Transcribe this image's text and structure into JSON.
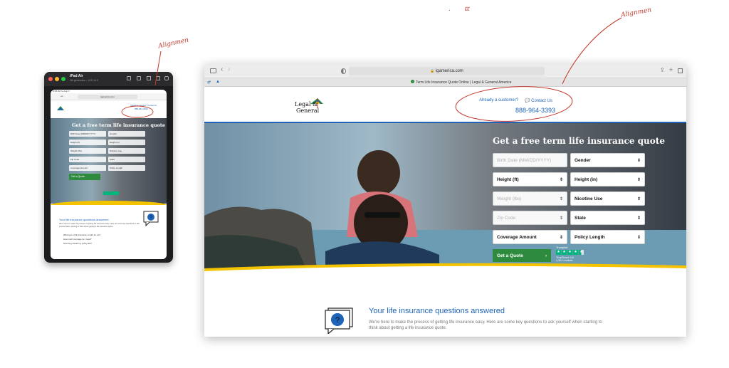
{
  "annotations": {
    "top_note": "ㄸ",
    "top_dot": ".",
    "ipad_note": "Alignmen",
    "browser_note": "Alignmen"
  },
  "simulator": {
    "device_name": "iPad Air",
    "device_sub": "4th generation – iOS 14.0",
    "status_time": "11:58 AM  Tue Aug 17",
    "address": "lgamerica.com",
    "tab_text": "aA",
    "mini_header": "Already a customer?  Contact Us",
    "mini_phone": "888-964-3393",
    "hero_title": "Get a free term life insurance quote",
    "fields": [
      [
        "Birth Date (MM/DD/YYYY)",
        "Gender"
      ],
      [
        "Height (ft)",
        "Height (in)"
      ],
      [
        "Weight (lbs)",
        "Nicotine Use"
      ],
      [
        "Zip Code",
        "State"
      ],
      [
        "Coverage Amount",
        "Policy Length"
      ]
    ],
    "cta": "Get a Quote",
    "section_title": "Your life insurance questions answered",
    "section_text": "We're here to make the process of getting life insurance easy. Here are some key questions to ask yourself when starting to think about getting a life insurance quote.",
    "q1": "What type of life insurance is right for me?",
    "q2": "How much coverage do I need?",
    "q3": "How long should my policy last?"
  },
  "browser": {
    "address": "lgamerica.com",
    "tab_title": "Term Life Insurance Quote Online | Legal & General America",
    "colors": {
      "accent": "#1d63b8",
      "cta_green": "#2e8b3e",
      "trustpilot": "#00b67a",
      "yellow": "#f3c300"
    }
  },
  "site": {
    "logo_line1": "Legal &",
    "logo_line2": "General",
    "already_customer": "Already a customer?",
    "contact_us": "Contact Us",
    "phone": "888-964-3393",
    "hero_title": "Get a free term life insurance quote",
    "form": {
      "birth_date": "Birth Date (MM/DD/YYYY)",
      "gender": "Gender",
      "height_ft": "Height (ft)",
      "height_in": "Height (in)",
      "weight": "Weight (lbs)",
      "nicotine": "Nicotine Use",
      "zip": "Zip Code",
      "state": "State",
      "coverage": "Coverage Amount",
      "policy_length": "Policy Length",
      "cta": "Get a Quote",
      "cta_arrow": "›"
    },
    "trustpilot": {
      "brand": "Trustpilot",
      "score": "TrustScore 4.8",
      "reviews": "1,301 reviews",
      "stars": 4.5
    },
    "section_title": "Your life insurance questions answered",
    "section_text": "We're here to make the process of getting life insurance easy. Here are some key questions to ask yourself when starting to think about getting a life insurance quote."
  }
}
